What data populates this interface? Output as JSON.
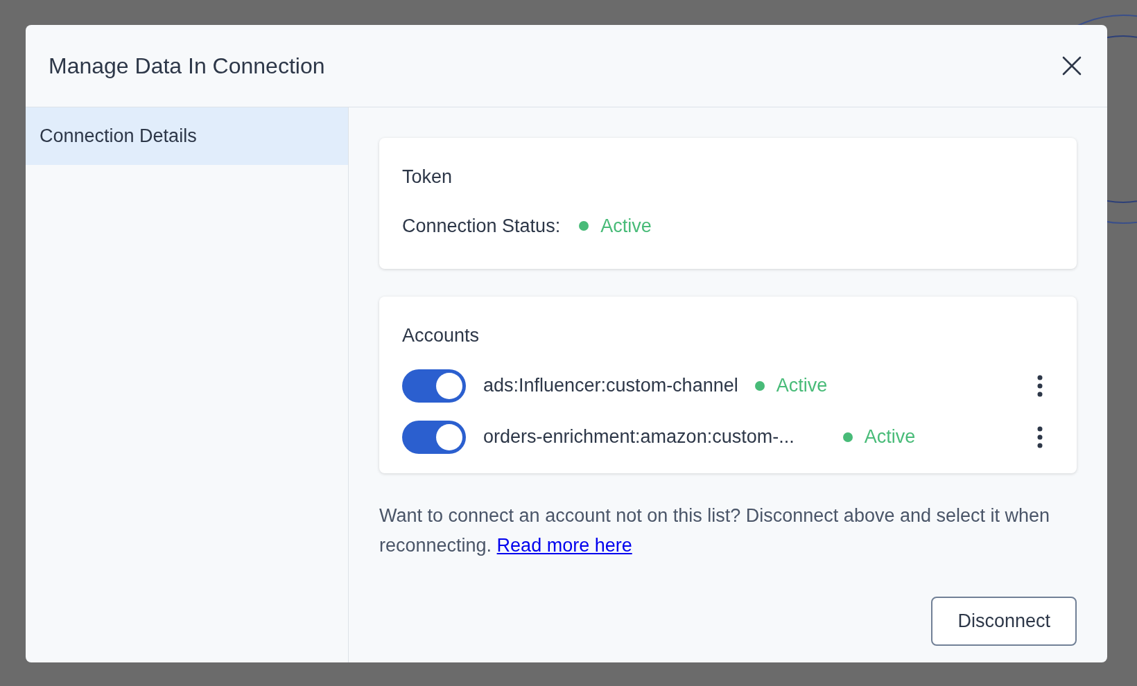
{
  "dialog": {
    "title": "Manage Data In Connection"
  },
  "sidebar": {
    "items": [
      {
        "label": "Connection Details",
        "selected": true
      }
    ]
  },
  "token_card": {
    "title": "Token",
    "status_label": "Connection Status:",
    "status": "Active",
    "color": "#48bb78"
  },
  "accounts_card": {
    "title": "Accounts",
    "accounts": [
      {
        "name": "ads:Influencer:custom-channel",
        "on": true,
        "status": "Active",
        "color": "#48bb78"
      },
      {
        "name": "orders-enrichment:amazon:custom-...",
        "on": true,
        "status": "Active",
        "color": "#48bb78"
      }
    ]
  },
  "note": {
    "text": "Want to connect an account not on this list? Disconnect above and select it when reconnecting.",
    "link": "Read more here"
  },
  "buttons": [
    {
      "label": "Disconnect"
    }
  ]
}
